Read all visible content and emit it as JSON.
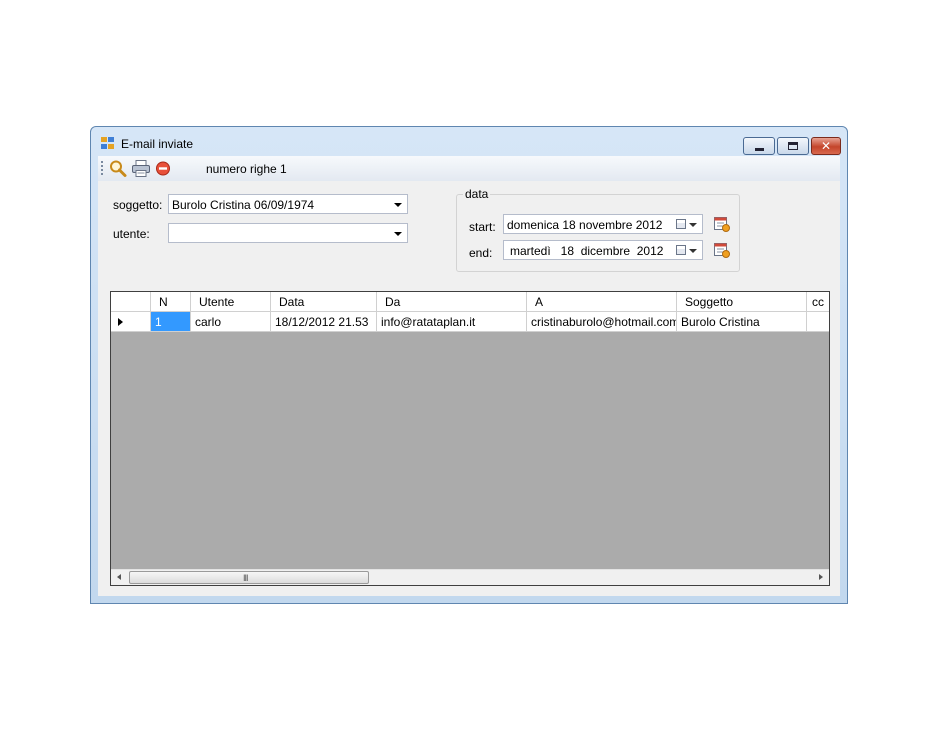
{
  "window": {
    "title": "E-mail inviate",
    "close_glyph": "✕"
  },
  "toolbar": {
    "search_icon": "search-icon",
    "print_icon": "print-icon",
    "delete_icon": "delete-icon",
    "rows_label": "numero righe 1"
  },
  "filters": {
    "subject_label": "soggetto:",
    "subject_value": "Burolo Cristina 06/09/1974",
    "user_label": "utente:",
    "user_value": ""
  },
  "date_group": {
    "title": "data",
    "start_label": "start:",
    "start_value": "domenica 18 novembre 2012",
    "end_label": "end:",
    "end_value": "martedì   18  dicembre  2012"
  },
  "grid": {
    "columns": [
      "N",
      "Utente",
      "Data",
      "Da",
      "A",
      "Soggetto",
      "cc"
    ],
    "rows": [
      {
        "cells": [
          "1",
          "carlo",
          "18/12/2012 21.53",
          "info@ratataplan.it",
          "cristinaburolo@hotmail.com",
          "Burolo Cristina",
          ""
        ]
      }
    ],
    "scroll_grip": "III"
  },
  "colors": {
    "selection": "#3399ff",
    "grid_background": "#ababab",
    "window_frame": "#c2d8ee"
  }
}
